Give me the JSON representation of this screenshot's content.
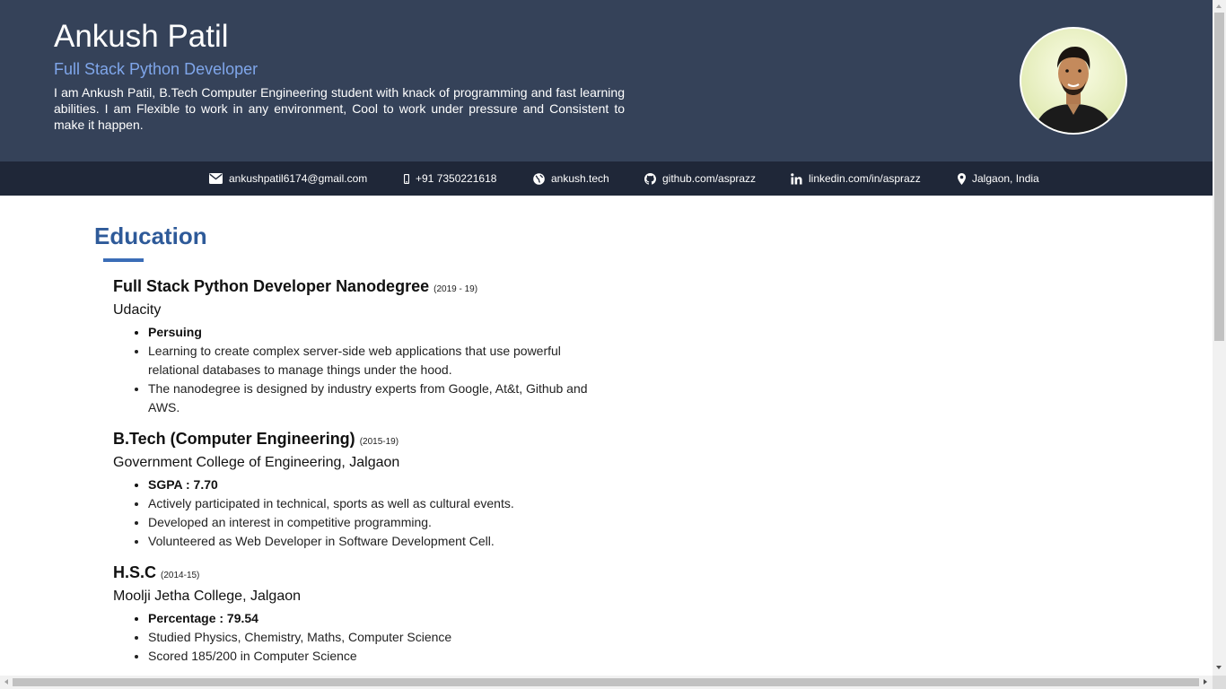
{
  "header": {
    "name": "Ankush Patil",
    "role": "Full Stack Python Developer",
    "summary": "I am Ankush Patil, B.Tech Computer Engineering student with knack of programming and fast learning abilities. I am Flexible to work in any environment, Cool  to work under pressure and  Consistent to make it happen.",
    "avatar_icon": "profile-photo"
  },
  "contacts": {
    "email": "ankushpatil6174@gmail.com",
    "phone": "+91 7350221618",
    "website": "ankush.tech",
    "github": "github.com/asprazz",
    "linkedin": "linkedin.com/in/asprazz",
    "location": "Jalgaon, India"
  },
  "education": {
    "title": "Education",
    "entries": [
      {
        "degree": "Full Stack Python Developer Nanodegree",
        "years": "(2019 - 19)",
        "institution": "Udacity",
        "points": [
          "Persuing",
          "Learning to create complex server-side web applications that use powerful relational databases to manage things under the hood.",
          "The nanodegree is designed by industry experts from Google, At&t, Github and AWS."
        ]
      },
      {
        "degree": "B.Tech (Computer Engineering)",
        "years": "(2015-19)",
        "institution": "Government College of Engineering, Jalgaon",
        "points": [
          "SGPA : 7.70",
          "Actively participated in technical, sports as well as cultural events.",
          "Developed an interest in competitive programming.",
          "Volunteered as Web Developer in Software Development Cell."
        ]
      },
      {
        "degree": "H.S.C",
        "years": "(2014-15)",
        "institution": "Moolji Jetha College, Jalgaon",
        "points": [
          "Percentage : 79.54",
          "Studied Physics, Chemistry, Maths, Computer Science",
          "Scored 185/200 in Computer Science"
        ]
      }
    ]
  },
  "colors": {
    "header_bg": "#354259",
    "contact_bar_bg": "#1f2738",
    "role_text": "#7fa6ea",
    "section_title": "#2e5a99"
  }
}
